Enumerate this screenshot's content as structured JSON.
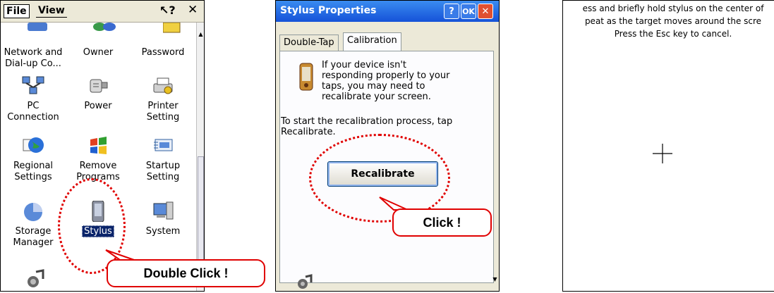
{
  "control_panel": {
    "menu": {
      "file": "File",
      "view": "View"
    },
    "items": [
      {
        "label": "Network and\nDial-up Co...",
        "icon": "network-icon"
      },
      {
        "label": "Owner",
        "icon": "owner-icon"
      },
      {
        "label": "Password",
        "icon": "password-icon"
      },
      {
        "label": "PC\nConnection",
        "icon": "pc-connection-icon"
      },
      {
        "label": "Power",
        "icon": "power-icon"
      },
      {
        "label": "Printer\nSetting",
        "icon": "printer-icon"
      },
      {
        "label": "Regional\nSettings",
        "icon": "globe-icon"
      },
      {
        "label": "Remove\nPrograms",
        "icon": "windows-logo-icon"
      },
      {
        "label": "Startup\nSetting",
        "icon": "startup-icon"
      },
      {
        "label": "Storage\nManager",
        "icon": "storage-icon"
      },
      {
        "label": "Stylus",
        "icon": "stylus-device-icon",
        "selected": true
      },
      {
        "label": "System",
        "icon": "system-icon"
      }
    ],
    "callout": "Double Click !"
  },
  "stylus_properties": {
    "title": "Stylus Properties",
    "ok_label": "OK",
    "tabs": [
      "Double-Tap",
      "Calibration"
    ],
    "active_tab": "Calibration",
    "message_1": "If your device isn't\nresponding properly to your\ntaps, you may need to\nrecalibrate your screen.",
    "message_2": "To start the recalibration process, tap\nRecalibrate.",
    "button_label": "Recalibrate",
    "callout": "Click !"
  },
  "calibration_screen": {
    "instructions": "ess and briefly hold stylus on the center of\npeat as the target moves around the scre\nPress the Esc key to cancel."
  },
  "colors": {
    "annotation": "#e00000",
    "titlebar": "#1552d8",
    "selection": "#0a246a"
  }
}
